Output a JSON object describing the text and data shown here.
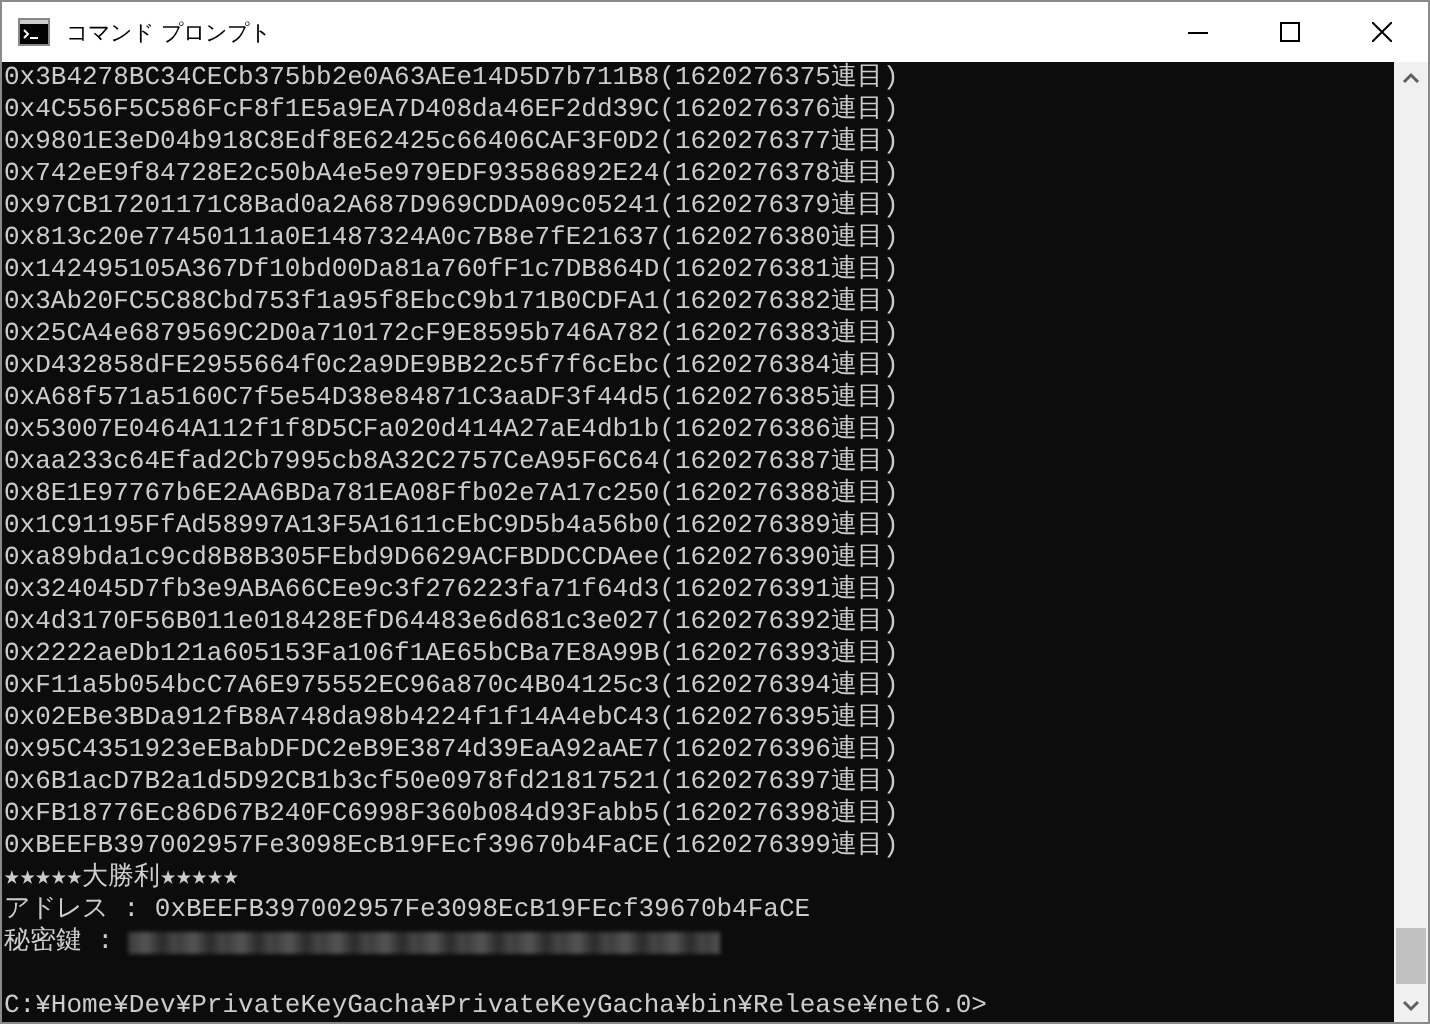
{
  "window": {
    "title": "コマンド プロンプト"
  },
  "output_lines": [
    "0x3B4278BC34CECb375bb2e0A63AEe14D5D7b711B8(1620276375連目)",
    "0x4C556F5C586FcF8f1E5a9EA7D408da46EF2dd39C(1620276376連目)",
    "0x9801E3eD04b918C8Edf8E62425c66406CAF3F0D2(1620276377連目)",
    "0x742eE9f84728E2c50bA4e5e979EDF93586892E24(1620276378連目)",
    "0x97CB17201171C8Bad0a2A687D969CDDA09c05241(1620276379連目)",
    "0x813c20e77450111a0E1487324A0c7B8e7fE21637(1620276380連目)",
    "0x142495105A367Df10bd00Da81a760fF1c7DB864D(1620276381連目)",
    "0x3Ab20FC5C88Cbd753f1a95f8EbcC9b171B0CDFA1(1620276382連目)",
    "0x25CA4e6879569C2D0a710172cF9E8595b746A782(1620276383連目)",
    "0xD432858dFE2955664f0c2a9DE9BB22c5f7f6cEbc(1620276384連目)",
    "0xA68f571a5160C7f5e54D38e84871C3aaDF3f44d5(1620276385連目)",
    "0x53007E0464A112f1f8D5CFa020d414A27aE4db1b(1620276386連目)",
    "0xaa233c64Efad2Cb7995cb8A32C2757CeA95F6C64(1620276387連目)",
    "0x8E1E97767b6E2AA6BDa781EA08Ffb02e7A17c250(1620276388連目)",
    "0x1C91195FfAd58997A13F5A1611cEbC9D5b4a56b0(1620276389連目)",
    "0xa89bda1c9cd8B8B305FEbd9D6629ACFBDDCCDAee(1620276390連目)",
    "0x324045D7fb3e9ABA66CEe9c3f276223fa71f64d3(1620276391連目)",
    "0x4d3170F56B011e018428EfD64483e6d681c3e027(1620276392連目)",
    "0x2222aeDb121a605153Fa106f1AE65bCBa7E8A99B(1620276393連目)",
    "0xF11a5b054bcC7A6E975552EC96a870c4B04125c3(1620276394連目)",
    "0x02EBe3BDa912fB8A748da98b4224f1f14A4ebC43(1620276395連目)",
    "0x95C4351923eEBabDFDC2eB9E3874d39EaA92aAE7(1620276396連目)",
    "0x6B1acD7B2a1d5D92CB1b3cf50e0978fd21817521(1620276397連目)",
    "0xFB18776Ec86D67B240FC6998F360b084d93Fabb5(1620276398連目)",
    "0xBEEFB397002957Fe3098EcB19FEcf39670b4FaCE(1620276399連目)"
  ],
  "result": {
    "banner": "★★★★★大勝利★★★★★",
    "address_line": "アドレス : 0xBEEFB397002957Fe3098EcB19FEcf39670b4FaCE",
    "private_key_label": "秘密鍵 : "
  },
  "prompt": "C:¥Home¥Dev¥PrivateKeyGacha¥PrivateKeyGacha¥bin¥Release¥net6.0>"
}
